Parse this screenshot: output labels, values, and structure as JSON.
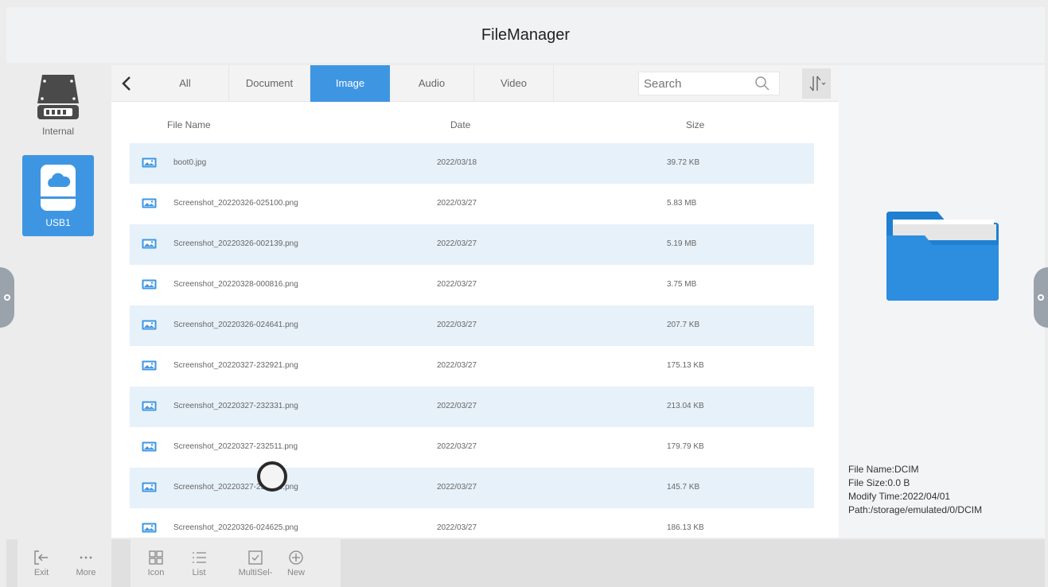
{
  "app": {
    "title": "FileManager"
  },
  "drives": [
    {
      "label": "Internal",
      "selected": false
    },
    {
      "label": "USB1",
      "selected": true
    }
  ],
  "tabs": [
    {
      "label": "All",
      "active": false
    },
    {
      "label": "Document",
      "active": false
    },
    {
      "label": "Image",
      "active": true
    },
    {
      "label": "Audio",
      "active": false
    },
    {
      "label": "Video",
      "active": false
    }
  ],
  "search": {
    "placeholder": "Search"
  },
  "list": {
    "headers": {
      "name": "File Name",
      "date": "Date",
      "size": "Size"
    },
    "rows": [
      {
        "name": "boot0.jpg",
        "date": "2022/03/18",
        "size": "39.72 KB"
      },
      {
        "name": "Screenshot_20220326-025100.png",
        "date": "2022/03/27",
        "size": "5.83 MB"
      },
      {
        "name": "Screenshot_20220326-002139.png",
        "date": "2022/03/27",
        "size": "5.19 MB"
      },
      {
        "name": "Screenshot_20220328-000816.png",
        "date": "2022/03/27",
        "size": "3.75 MB"
      },
      {
        "name": "Screenshot_20220326-024641.png",
        "date": "2022/03/27",
        "size": "207.7 KB"
      },
      {
        "name": "Screenshot_20220327-232921.png",
        "date": "2022/03/27",
        "size": "175.13 KB"
      },
      {
        "name": "Screenshot_20220327-232331.png",
        "date": "2022/03/27",
        "size": "213.04 KB"
      },
      {
        "name": "Screenshot_20220327-232511.png",
        "date": "2022/03/27",
        "size": "179.79 KB"
      },
      {
        "name": "Screenshot_20220327-232510.png",
        "date": "2022/03/27",
        "size": "145.7 KB"
      },
      {
        "name": "Screenshot_20220326-024625.png",
        "date": "2022/03/27",
        "size": "186.13 KB"
      }
    ]
  },
  "details": {
    "name": "File Name:DCIM",
    "size": "File Size:0.0 B",
    "modified": "Modify Time:2022/04/01",
    "path": "Path:/storage/emulated/0/DCIM"
  },
  "toolbar": {
    "exit": "Exit",
    "more": "More",
    "icon": "Icon",
    "list": "List",
    "multiselect": "MultiSel-",
    "new": "New"
  },
  "colors": {
    "accent": "#3e96e3",
    "row_alt": "#e7f1fa",
    "folder": "#1f7fd0"
  },
  "icons": [
    "back-arrow-icon",
    "search-icon",
    "sort-icon",
    "drive-icon",
    "usb-cloud-icon",
    "image-file-icon",
    "folder-icon",
    "exit-icon",
    "more-icon",
    "grid-icon",
    "list-icon",
    "checkbox-icon",
    "plus-circle-icon"
  ]
}
